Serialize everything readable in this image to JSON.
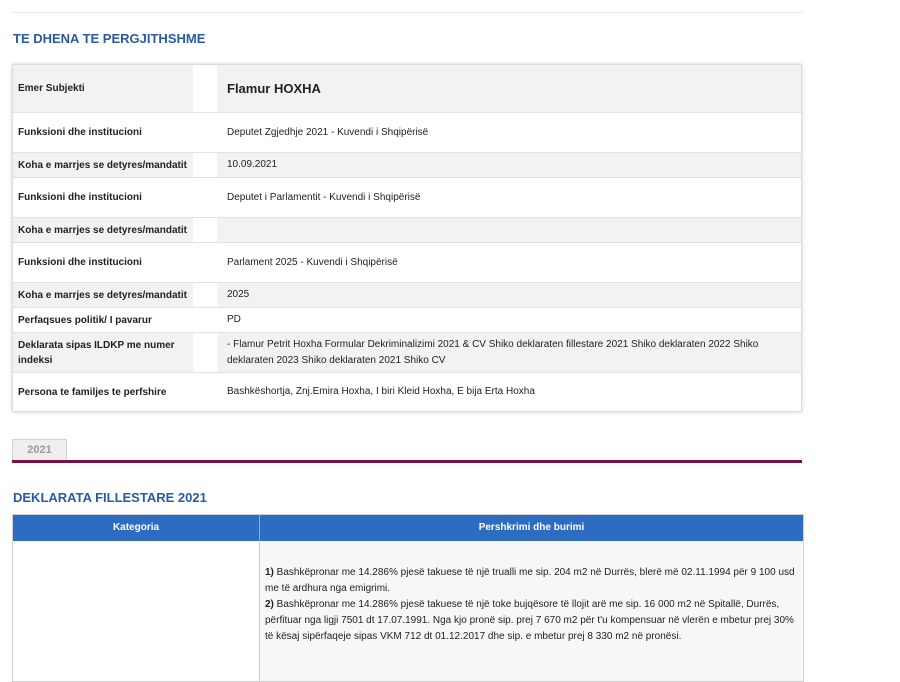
{
  "section_general": {
    "title": "TE DHENA TE PERGJITHSHME"
  },
  "subject": {
    "label": "Emer Subjekti",
    "name": "Flamur HOXHA"
  },
  "rows": [
    {
      "label": "Funksioni dhe institucioni",
      "value": "Deputet Zgjedhje 2021 - Kuvendi i Shqipërisë"
    },
    {
      "label": "Koha e marrjes se detyres/mandatit",
      "value": "10.09.2021"
    },
    {
      "label": "Funksioni dhe institucioni",
      "value": "Deputet i Parlamentit - Kuvendi i Shqipërisë"
    },
    {
      "label": "Koha e marrjes se detyres/mandatit",
      "value": ""
    },
    {
      "label": "Funksioni dhe institucioni",
      "value": "Parlament 2025 - Kuvendi i Shqipërisë"
    },
    {
      "label": "Koha e marrjes se detyres/mandatit",
      "value": "2025"
    },
    {
      "label": "Perfaqsues politik/ I pavarur",
      "value": "PD"
    },
    {
      "label": "Deklarata sipas ILDKP me numer indeksi",
      "value": "- Flamur Petrit Hoxha Formular Dekriminalizimi 2021 & CV Shiko deklaraten fillestare 2021 Shiko deklaraten 2022 Shiko deklaraten 2023 Shiko deklaraten 2021 Shiko CV"
    },
    {
      "label": "Persona te familjes te perfshire",
      "value": "Bashkëshortja, Znj.Emira Hoxha, I biri Kleid Hoxha, E bija Erta Hoxha"
    }
  ],
  "tabs": {
    "active": "2021"
  },
  "declaration": {
    "title": "DEKLARATA FILLESTARE 2021",
    "col_category": "Kategoria",
    "col_description": "Pershkrimi dhe burimi",
    "items": [
      {
        "num": "1)",
        "text": " Bashkëpronar me 14.286% pjesë takuese të një trualli me sip. 204 m2 në Durrës, blerë më 02.11.1994 për 9 100 usd me të ardhura nga emigrimi."
      },
      {
        "num": "2)",
        "text": " Bashkëpronar me 14.286% pjesë takuese të një toke bujqësore të llojit arë me sip. 16 000 m2 në Spitallë, Durrës, përfituar nga ligji 7501 dt 17.07.1991. Nga kjo pronë sip. prej 7 670 m2 për t'u kompensuar në vlerën e mbetur prej 30% të kësaj sipërfaqeje sipas VKM 712 dt 01.12.2017 dhe sip. e mbetur prej 8 330 m2 në pronësi."
      }
    ]
  },
  "colors": {
    "accent_blue": "#2a5aa5",
    "header_blue": "#2d6cc0",
    "maroon": "#7a1040"
  }
}
